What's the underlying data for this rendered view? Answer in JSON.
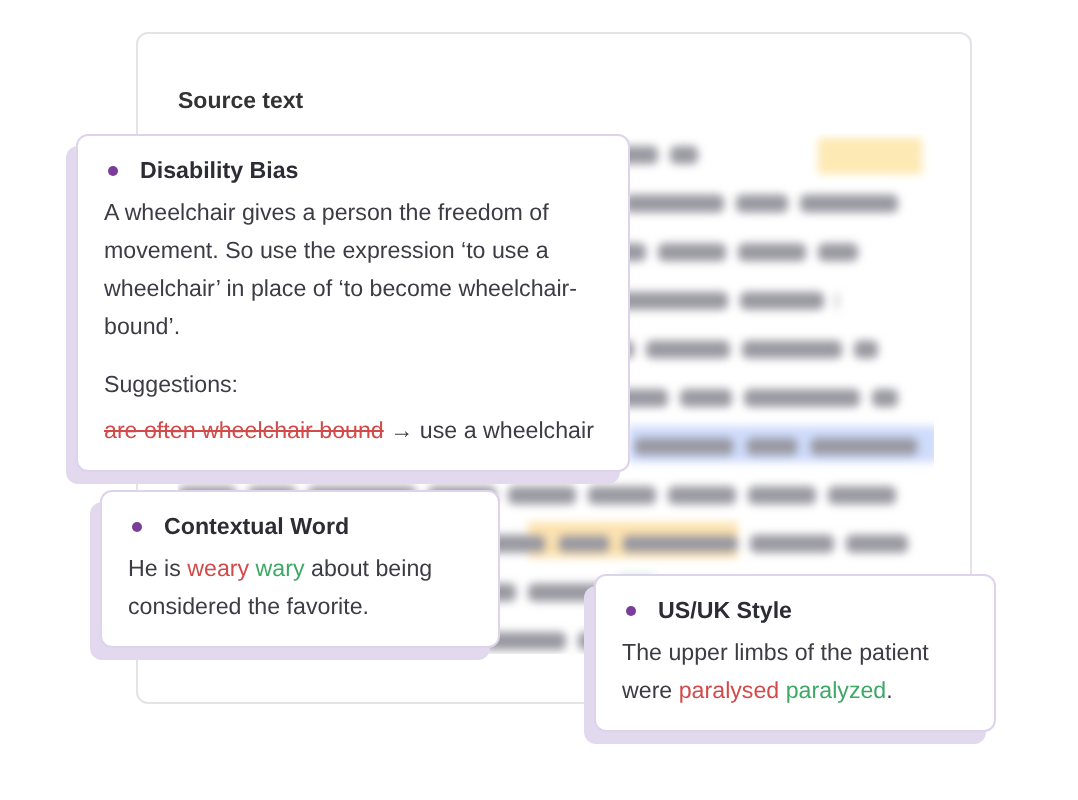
{
  "source": {
    "title": "Source text"
  },
  "cards": [
    {
      "title": "Disability Bias",
      "body": [
        {
          "kind": "plain",
          "text": "A wheelchair gives a person the freedom of movement. So use the expression ‘to use a wheelchair’ in place of ‘to become wheelchair-bound’."
        }
      ],
      "suggestions_label": "Suggestions:",
      "suggestion": [
        {
          "kind": "struck",
          "text": "are often wheelchair bound"
        },
        {
          "kind": "plain",
          "text": " → "
        },
        {
          "kind": "plain",
          "text": "use a wheelchair"
        }
      ]
    },
    {
      "title": "Contextual Word",
      "body": [
        {
          "kind": "plain",
          "text": "He is "
        },
        {
          "kind": "wrong",
          "text": "weary"
        },
        {
          "kind": "right",
          "text": " wary"
        },
        {
          "kind": "plain",
          "text": " about being considered the favorite."
        }
      ]
    },
    {
      "title": "US/UK Style",
      "body": [
        {
          "kind": "plain",
          "text": "The upper limbs of the patient were "
        },
        {
          "kind": "wrong",
          "text": "paralysed"
        },
        {
          "kind": "right",
          "text": " paralyzed"
        },
        {
          "kind": "plain",
          "text": "."
        }
      ]
    }
  ]
}
